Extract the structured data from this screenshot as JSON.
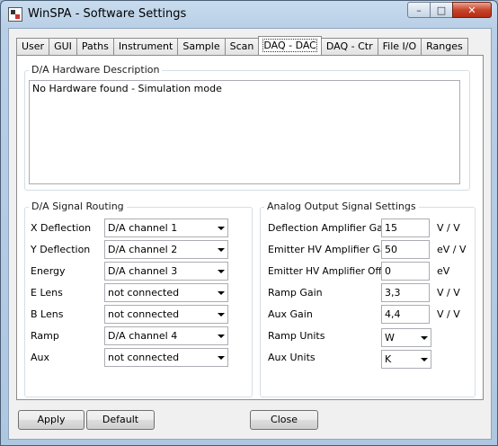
{
  "window": {
    "title": "WinSPA - Software Settings",
    "min": "–",
    "max": "□",
    "close": "✕"
  },
  "tabs": [
    "User",
    "GUI",
    "Paths",
    "Instrument",
    "Sample",
    "Scan",
    "DAQ - DAC",
    "DAQ - Ctr",
    "File I/O",
    "Ranges"
  ],
  "active_tab": "DAQ - DAC",
  "hardware": {
    "legend": "D/A Hardware Description",
    "text": "No Hardware found - Simulation mode"
  },
  "routing": {
    "legend": "D/A Signal Routing",
    "rows": [
      {
        "label": "X Deflection",
        "value": "D/A channel 1"
      },
      {
        "label": "Y Deflection",
        "value": "D/A channel 2"
      },
      {
        "label": "Energy",
        "value": "D/A channel 3"
      },
      {
        "label": "E Lens",
        "value": "not connected"
      },
      {
        "label": "B Lens",
        "value": "not connected"
      },
      {
        "label": "Ramp",
        "value": "D/A channel 4"
      },
      {
        "label": "Aux",
        "value": "not connected"
      }
    ]
  },
  "analog": {
    "legend": "Analog Output Signal Settings",
    "deflection_gain": {
      "label": "Deflection Amplifier Gain",
      "value": "15",
      "unit": "V / V"
    },
    "emitter_gain": {
      "label": "Emitter HV Amplifier Gain",
      "value": "50",
      "unit": "eV / V"
    },
    "emitter_offset": {
      "label": "Emitter HV Amplifier Offset",
      "value": "0",
      "unit": "eV"
    },
    "ramp_gain": {
      "label": "Ramp Gain",
      "value": "3,3",
      "unit": "V / V"
    },
    "aux_gain": {
      "label": "Aux Gain",
      "value": "4,4",
      "unit": "V / V"
    },
    "ramp_units": {
      "label": "Ramp Units",
      "value": "W"
    },
    "aux_units": {
      "label": "Aux Units",
      "value": "K"
    }
  },
  "buttons": {
    "apply": "Apply",
    "default": "Default",
    "close": "Close"
  }
}
